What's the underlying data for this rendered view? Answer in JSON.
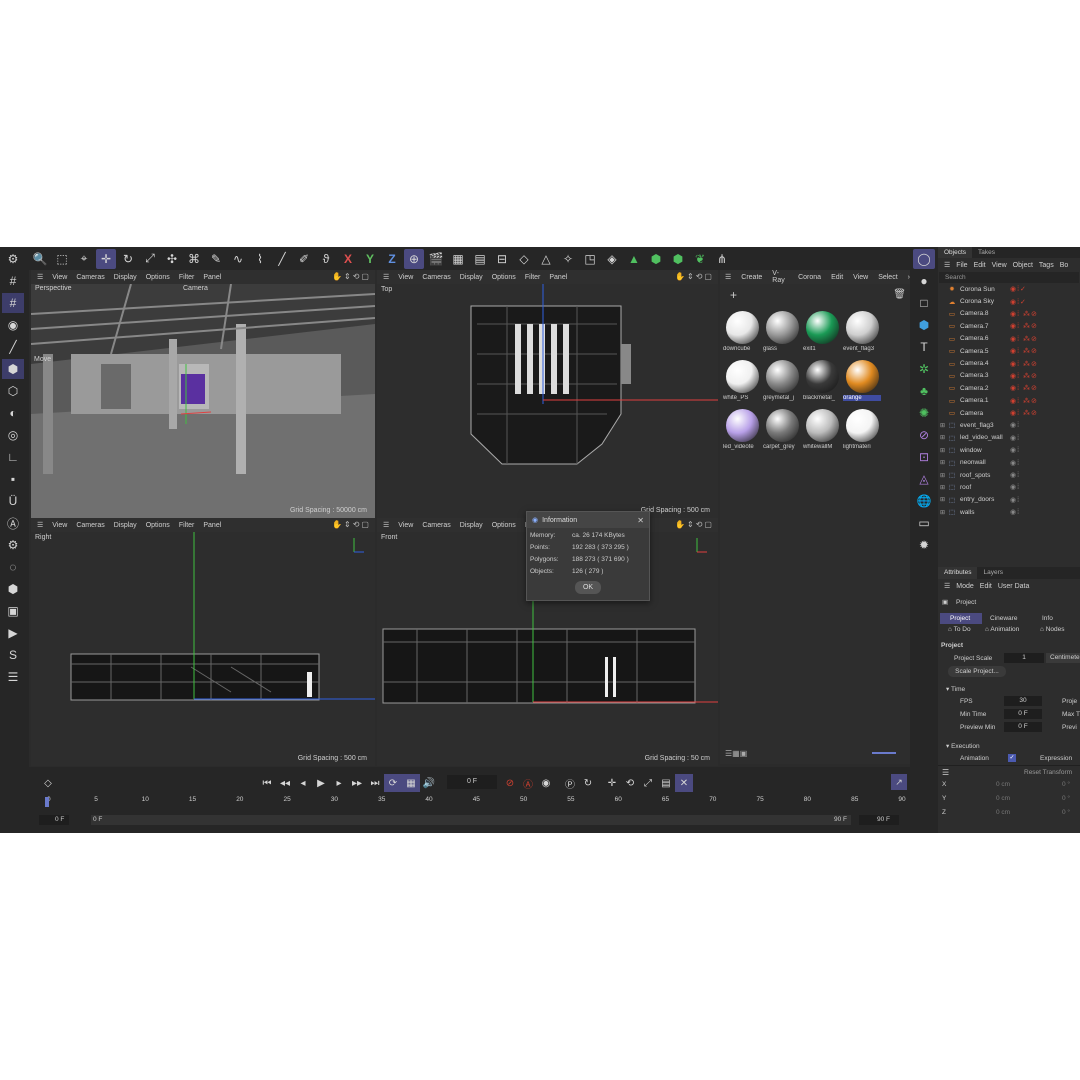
{
  "viewport_menu": [
    "View",
    "Cameras",
    "Display",
    "Options",
    "Filter",
    "Panel"
  ],
  "viewports": {
    "perspective": {
      "name": "Perspective",
      "camera": "Camera",
      "grid": "Grid Spacing : 50000 cm",
      "move_label": "Move"
    },
    "top": {
      "name": "Top",
      "grid": "Grid Spacing : 500 cm"
    },
    "right": {
      "name": "Right",
      "grid": "Grid Spacing : 500 cm"
    },
    "front": {
      "name": "Front",
      "grid": "Grid Spacing : 50 cm"
    }
  },
  "axis_labels": {
    "x": "X",
    "y": "Y",
    "z": "Z"
  },
  "material_menu": [
    "Create",
    "V-Ray",
    "Corona",
    "Edit",
    "View",
    "Select"
  ],
  "materials": [
    {
      "label": "downcube",
      "color": "#e8e8e8",
      "selected": false
    },
    {
      "label": "glass",
      "color": "#9a9a9a",
      "selected": false
    },
    {
      "label": "exit1",
      "color": "#1a9a55",
      "selected": false
    },
    {
      "label": "event_flag3",
      "color": "#cfcfcf",
      "selected": false
    },
    {
      "label": "white_PS",
      "color": "#f0f0f0",
      "selected": false
    },
    {
      "label": "greymetal_j",
      "color": "#8a8a8a",
      "selected": false
    },
    {
      "label": "blackmetal_",
      "color": "#3a3a3a",
      "selected": false
    },
    {
      "label": "orange",
      "color": "#e08a20",
      "selected": true
    },
    {
      "label": "led_videote",
      "color": "#b8a0e8",
      "selected": false
    },
    {
      "label": "carpet_grey",
      "color": "#7a7a7a",
      "selected": false
    },
    {
      "label": "whitewallM",
      "color": "#bcbcbc",
      "selected": false
    },
    {
      "label": "lightmateri",
      "color": "#f4f4f4",
      "selected": false
    }
  ],
  "objects_panel": {
    "tabs": [
      "Objects",
      "Takes"
    ],
    "menu": [
      "File",
      "Edit",
      "View",
      "Object",
      "Tags",
      "Bo"
    ],
    "search": "Search",
    "items": [
      {
        "name": "Corona Sun",
        "icon": "sun-icon",
        "group": false
      },
      {
        "name": "Corona Sky",
        "icon": "sky-icon",
        "group": false
      },
      {
        "name": "Camera.8",
        "icon": "camera-icon",
        "group": false
      },
      {
        "name": "Camera.7",
        "icon": "camera-icon",
        "group": false
      },
      {
        "name": "Camera.6",
        "icon": "camera-icon",
        "group": false
      },
      {
        "name": "Camera.5",
        "icon": "camera-icon",
        "group": false
      },
      {
        "name": "Camera.4",
        "icon": "camera-icon",
        "group": false
      },
      {
        "name": "Camera.3",
        "icon": "camera-icon",
        "group": false
      },
      {
        "name": "Camera.2",
        "icon": "camera-icon",
        "group": false
      },
      {
        "name": "Camera.1",
        "icon": "camera-icon",
        "group": false
      },
      {
        "name": "Camera",
        "icon": "camera-icon",
        "group": false
      },
      {
        "name": "event_flag3",
        "icon": "null-icon",
        "group": true
      },
      {
        "name": "led_video_wall",
        "icon": "null-icon",
        "group": true
      },
      {
        "name": "window",
        "icon": "null-icon",
        "group": true
      },
      {
        "name": "neonwall",
        "icon": "null-icon",
        "group": true
      },
      {
        "name": "roof_spots",
        "icon": "null-icon",
        "group": true
      },
      {
        "name": "roof",
        "icon": "null-icon",
        "group": true
      },
      {
        "name": "entry_doors",
        "icon": "null-icon",
        "group": true
      },
      {
        "name": "walls",
        "icon": "null-icon",
        "group": true
      }
    ]
  },
  "attributes": {
    "tabs": [
      "Attributes",
      "Layers"
    ],
    "menu": [
      "Mode",
      "Edit",
      "User Data"
    ],
    "object": "Project",
    "subtabs": [
      "Project",
      "Cineware",
      "Info"
    ],
    "subtabs2": [
      "To Do",
      "Animation",
      "Nodes"
    ],
    "section": "Project",
    "project_scale_label": "Project Scale",
    "project_scale_value": "1",
    "project_scale_unit": "Centimete",
    "scale_button": "Scale Project...",
    "time_section": "Time",
    "fps_label": "FPS",
    "fps_value": "30",
    "proje_label": "Proje",
    "min_time_label": "Min Time",
    "min_time_value": "0 F",
    "max_label": "Max T",
    "preview_min_label": "Preview Min",
    "preview_min_value": "0 F",
    "previ_label": "Previ",
    "execution_section": "Execution",
    "animation_label": "Animation",
    "expression_label": "Expression",
    "reset_transform": "Reset Transform",
    "coords": [
      {
        "axis": "X",
        "pos": "0 cm",
        "rot": "0 °"
      },
      {
        "axis": "Y",
        "pos": "0 cm",
        "rot": "0 °"
      },
      {
        "axis": "Z",
        "pos": "0 cm",
        "rot": "0 °"
      }
    ]
  },
  "info_dialog": {
    "title": "Information",
    "rows": [
      {
        "label": "Memory:",
        "value": "ca. 26 174 KBytes"
      },
      {
        "label": "Points:",
        "value": "192 283 ( 373 295 )"
      },
      {
        "label": "Polygons:",
        "value": "188 273 ( 371 690 )"
      },
      {
        "label": "Objects:",
        "value": "126 ( 279 )"
      }
    ],
    "ok": "OK"
  },
  "timeline": {
    "current_frame": "0 F",
    "ticks": [
      "0",
      "5",
      "10",
      "15",
      "20",
      "25",
      "30",
      "35",
      "40",
      "45",
      "50",
      "55",
      "60",
      "65",
      "70",
      "75",
      "80",
      "85",
      "90"
    ],
    "start_frame": "0 F",
    "start_frame2": "0 F",
    "end_frame": "90 F",
    "end_frame2": "90 F"
  },
  "colors": {
    "accent": "#4b4a80",
    "selection": "#3f4ca0",
    "record": "#d04030"
  }
}
